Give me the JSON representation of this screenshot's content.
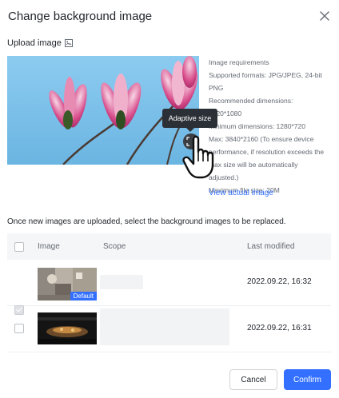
{
  "dialog": {
    "title": "Change background image"
  },
  "upload": {
    "label": "Upload image"
  },
  "tooltip": {
    "text": "Adaptive size"
  },
  "requirements": {
    "lines": [
      "Image requirements",
      "Supported formats: JPG/JPEG, 24-bit",
      "PNG",
      "Recommended dimensions:",
      "1920*1080",
      "Minimum dimensions: 1280*720",
      "Max: 3840*2160 (To ensure device",
      "performance, if resolution exceeds the",
      "max size will be automatically",
      "adjusted.)",
      "Maximum file size: 20M"
    ],
    "view_link": "View actual image"
  },
  "hint": "Once new images are uploaded, select the background images to be replaced.",
  "table": {
    "headers": {
      "image": "Image",
      "scope": "Scope",
      "last_modified": "Last modified"
    },
    "rows": [
      {
        "checked": true,
        "badge": "Default",
        "last_modified": "2022.09.22, 16:32"
      },
      {
        "checked": false,
        "badge": "",
        "last_modified": "2022.09.22, 16:31"
      }
    ]
  },
  "footer": {
    "cancel": "Cancel",
    "confirm": "Confirm"
  },
  "colors": {
    "accent": "#3370ff",
    "sky": "#7ec3ea",
    "tooltip_bg": "#2b2f36"
  }
}
